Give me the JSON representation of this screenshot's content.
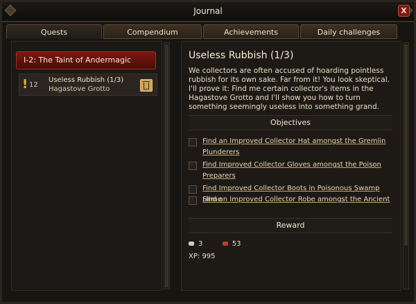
{
  "window": {
    "title": "Journal",
    "close_label": "X"
  },
  "tabs": [
    {
      "label": "Quests",
      "active": true
    },
    {
      "label": "Compendium",
      "active": false
    },
    {
      "label": "Achievements",
      "active": false
    },
    {
      "label": "Daily challenges",
      "active": false
    }
  ],
  "left": {
    "chapter": "I-2: The Taint of Andermagic",
    "quest": {
      "marker": "!",
      "level": "12",
      "name": "Useless Rubbish (1/3)",
      "location": "Hagastove Grotto"
    }
  },
  "right": {
    "title": "Useless Rubbish (1/3)",
    "description": "We collectors are often accused of hoarding pointless rubbish for its own sake. Far from it! You look skeptical. I'll prove it: Find me certain collector's items in the Hagastove Grotto and I'll show you how to turn something seemingly useless into something grand.",
    "objectives_header": "Objectives",
    "objectives": [
      "Find an Improved Collector Hat amongst the Gremlin Plunderers",
      "Find Improved Collector Gloves amongst the Poison Preparers",
      "Find Improved Collector Boots in Poisonous Swamp Slime",
      "Find an Improved Collector Robe amongst the Ancient"
    ],
    "reward_header": "Reward",
    "reward": {
      "silver": "3",
      "rubies": "53",
      "xp_label": "XP:",
      "xp": "995"
    }
  },
  "colors": {
    "accent_red": "#7a1812",
    "gold": "#e3b21d"
  }
}
